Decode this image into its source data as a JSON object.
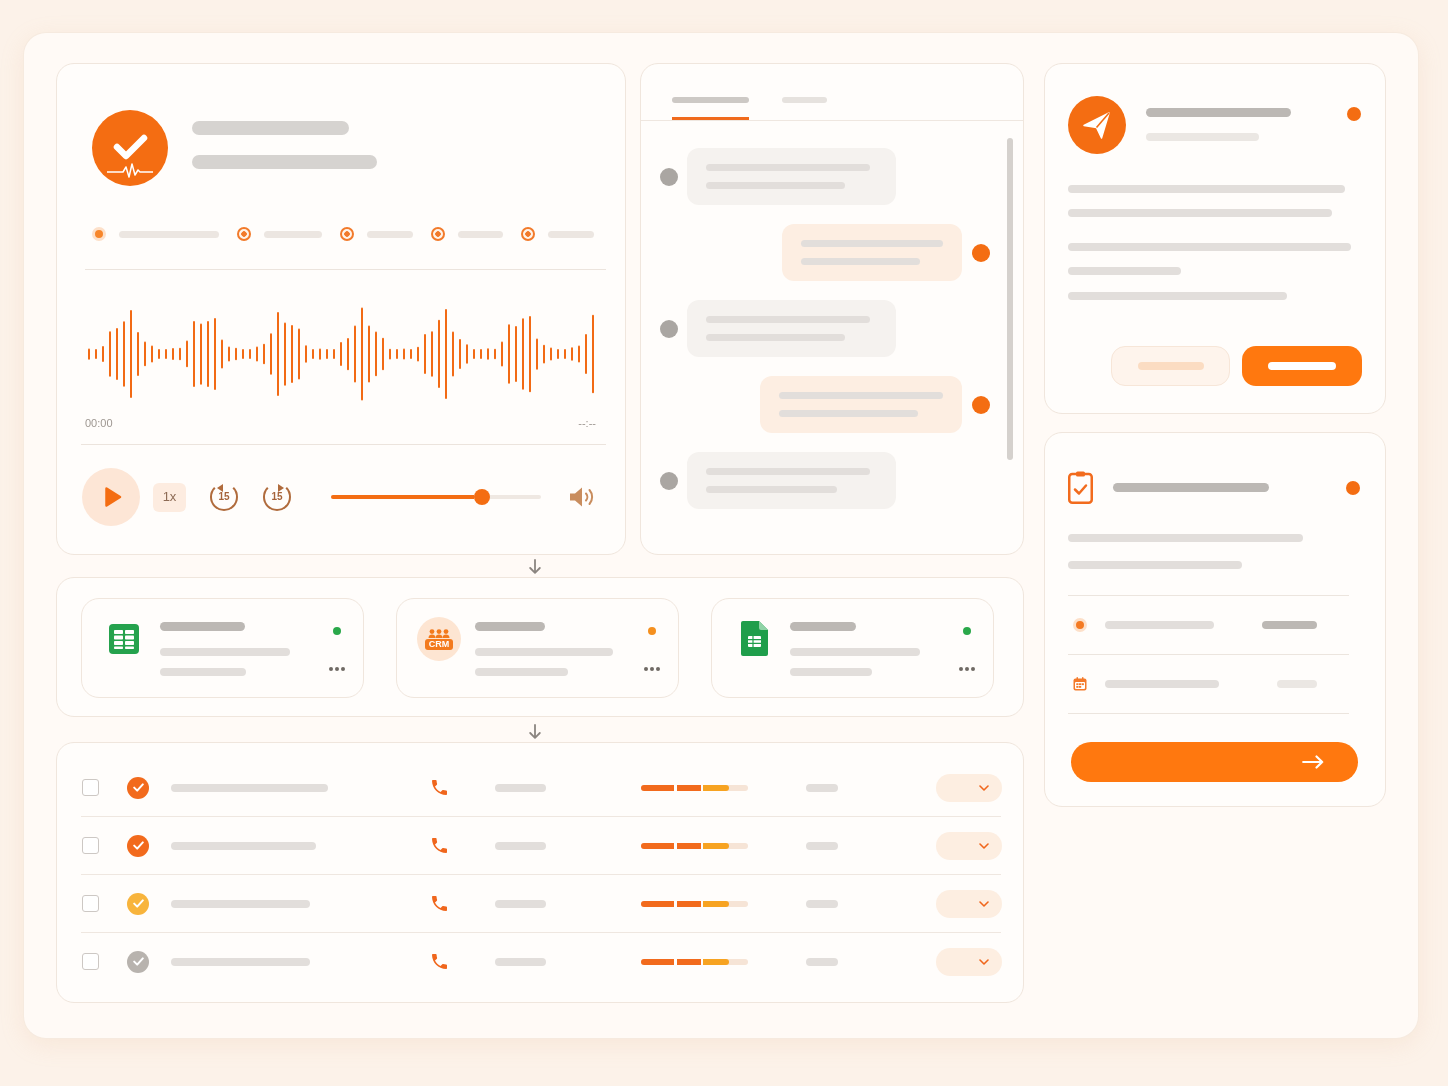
{
  "recorder": {
    "steps": [
      {
        "selected": true
      },
      {
        "selected": false
      },
      {
        "selected": false
      },
      {
        "selected": false
      },
      {
        "selected": false
      }
    ],
    "time_elapsed": "00:00",
    "time_total": "--:--",
    "speed": "1x",
    "skip_back": "15",
    "skip_forward": "15",
    "volume": {
      "level": 0.72
    }
  },
  "chat": {
    "tabs": [
      {
        "selected": true
      },
      {
        "selected": false
      }
    ],
    "messages": [
      {
        "kind": "incoming"
      },
      {
        "kind": "outgoing"
      },
      {
        "kind": "incoming"
      },
      {
        "kind": "outgoing"
      },
      {
        "kind": "incoming"
      }
    ]
  },
  "integrations": [
    {
      "kind": "spreadsheet",
      "color": "#2aa84a"
    },
    {
      "kind": "crm",
      "label": "CRM",
      "color": "#f5901e"
    },
    {
      "kind": "document",
      "color": "#2aa84a"
    }
  ],
  "calls": [
    {
      "checked": false,
      "color": "#f26a1c",
      "level": 0.82
    },
    {
      "checked": false,
      "color": "#f26a1c",
      "level": 0.82
    },
    {
      "checked": false,
      "color": "#f8b43c",
      "level": 0.82
    },
    {
      "checked": false,
      "color": "#b8b3ae",
      "level": 0.82
    }
  ]
}
